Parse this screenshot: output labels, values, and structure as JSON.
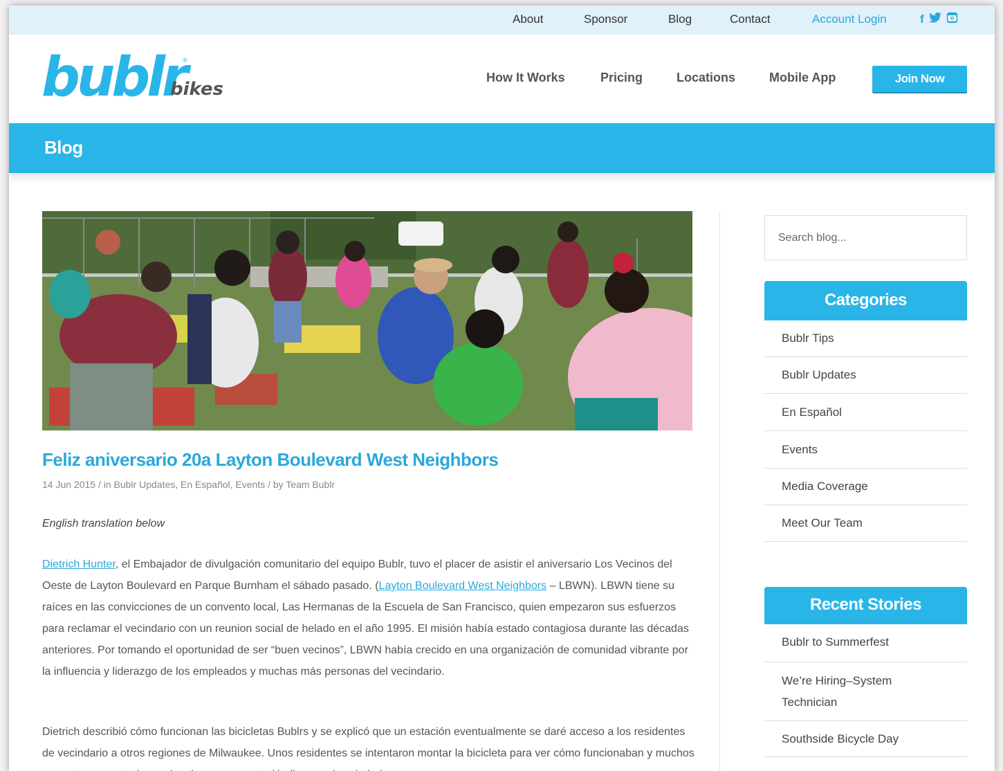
{
  "topbar": {
    "links": [
      "About",
      "Sponsor",
      "Blog",
      "Contact",
      "Account Login"
    ],
    "social": [
      "facebook-icon",
      "twitter-icon",
      "instagram-icon"
    ]
  },
  "header": {
    "logo_main": "bublr",
    "logo_sub": "bikes",
    "nav": [
      "How It Works",
      "Pricing",
      "Locations",
      "Mobile App"
    ],
    "cta": "Join Now"
  },
  "blogbar": {
    "title": "Blog"
  },
  "post": {
    "title": "Feliz aniversario 20a Layton Boulevard West Neighbors",
    "meta": "14 Jun 2015 / in Bublr Updates, En Español, Events / by Team Bublr",
    "intro": "English translation below",
    "p1_link1": "Dietrich Hunter",
    "p1_text1": ", el Embajador de divulgación comunitario del equipo Bublr, tuvo el placer de asistir el aniversario Los Vecinos del Oeste de Layton Boulevard en Parque Burnham el sábado pasado. (",
    "p1_link2": "Layton Boulevard West Neighbors",
    "p1_text2": " – LBWN). LBWN tiene su raíces en las convicciones de un convento local, Las Hermanas de la Escuela de San Francisco, quien empezaron sus esfuerzos para reclamar el vecindario con un reunion social de helado en el año 1995. El misión había estado contagiosa durante las décadas anteriores. Por tomando el oportunidad de ser “buen vecinos”, LBWN había crecido en una organización de comunidad vibrante por la influencia y liderazgo de los empleados y muchas más personas del vecindario.",
    "p2": "Dietrich describió cómo funcionan las bicicletas Bublrs y se explicó que un estación eventualmente se daré acceso a los residentes de vecindario a otros regiones de Milwaukee. Unos residentes se intentaron montar la bicicleta para ver cómo funcionaban y muchos se mostraron entusiasmados de que una estación llegara al vecindario."
  },
  "sidebar": {
    "search_placeholder": "Search blog...",
    "categories_title": "Categories",
    "categories": [
      "Bublr Tips",
      "Bublr Updates",
      "En Español",
      "Events",
      "Media Coverage",
      "Meet Our Team"
    ],
    "recent_title": "Recent Stories",
    "recent": [
      "Bublr to Summerfest",
      "We’re Hiring–System Technician",
      "Southside Bicycle Day"
    ]
  },
  "colors": {
    "brand": "#29b5e8",
    "topbar_bg": "#e1f1fa"
  }
}
